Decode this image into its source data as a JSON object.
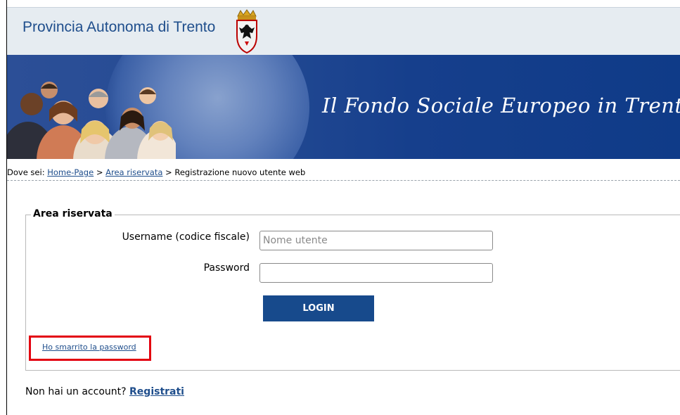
{
  "header": {
    "site_title": "Provincia Autonoma di Trento",
    "banner_title": "Il Fondo Sociale Europeo in Trentino",
    "colors": {
      "header_bg": "#e6ecf1",
      "banner_bg": "#163f8c",
      "brand_text": "#1f4e8c"
    }
  },
  "breadcrumb": {
    "prefix": "Dove sei:",
    "items": [
      {
        "label": "Home-Page",
        "link": true
      },
      {
        "label": "Area riservata",
        "link": true
      },
      {
        "label": "Registrazione nuovo utente web",
        "link": false
      }
    ],
    "separator": ">"
  },
  "login": {
    "legend": "Area riservata",
    "username_label": "Username (codice fiscale)",
    "username_placeholder": "Nome utente",
    "username_value": "",
    "password_label": "Password",
    "password_value": "",
    "login_button": "LOGIN",
    "forgot_link": "Ho smarrito la password",
    "button_color": "#174a8c",
    "highlight_color": "#e3000f"
  },
  "register": {
    "prompt": "Non hai un account?",
    "link": "Registrati"
  }
}
